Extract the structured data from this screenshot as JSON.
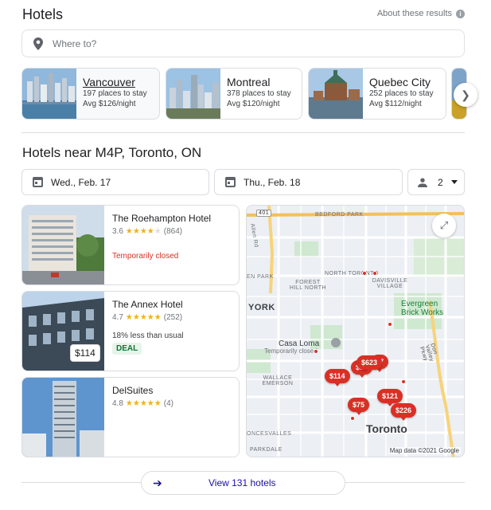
{
  "header": {
    "title": "Hotels",
    "about": "About these results"
  },
  "search": {
    "placeholder": "Where to?"
  },
  "cities": [
    {
      "name": "Vancouver",
      "places": "197 places to stay",
      "avg": "Avg $126/night"
    },
    {
      "name": "Montreal",
      "places": "378 places to stay",
      "avg": "Avg $120/night"
    },
    {
      "name": "Quebec City",
      "places": "252 places to stay",
      "avg": "Avg $112/night"
    }
  ],
  "near": {
    "title": "Hotels near M4P, Toronto, ON"
  },
  "filters": {
    "checkin": "Wed., Feb. 17",
    "checkout": "Thu., Feb. 18",
    "guests": "2"
  },
  "hotels": [
    {
      "name": "The Roehampton Hotel",
      "rating": "3.6",
      "reviews": "(864)",
      "status": "Temporarily closed"
    },
    {
      "name": "The Annex Hotel",
      "rating": "4.7",
      "reviews": "(252)",
      "note": "18% less than usual",
      "deal": "DEAL",
      "price": "$114"
    },
    {
      "name": "DelSuites",
      "rating": "4.8",
      "reviews": "(4)"
    }
  ],
  "map": {
    "labels": {
      "bedford": "BEDFORD PARK",
      "hwy401": "401",
      "allen": "Allen Rd",
      "northtoronto": "NORTH TORONTO",
      "davisville": "DAVISVILLE VILLAGE",
      "forest": "FOREST HILL NORTH",
      "lenpark": "EN PARK",
      "york": "YORK",
      "evergreen": "Evergreen Brick Works",
      "casaloma": "Casa Loma",
      "casaclosed": "Temporarily closed",
      "wallace": "WALLACE EMERSON",
      "toronto": "Toronto",
      "roncesvalles": "ONCESVALLES",
      "parkdale": "PARKDALE",
      "donvalley": "Don Valley Pkwy",
      "credit": "Map data ©2021 Google"
    },
    "pins": [
      "$623",
      "$114",
      "$75",
      "$121",
      "$226",
      "$7",
      "$24"
    ]
  },
  "footer": {
    "view_all": "View 131 hotels"
  }
}
